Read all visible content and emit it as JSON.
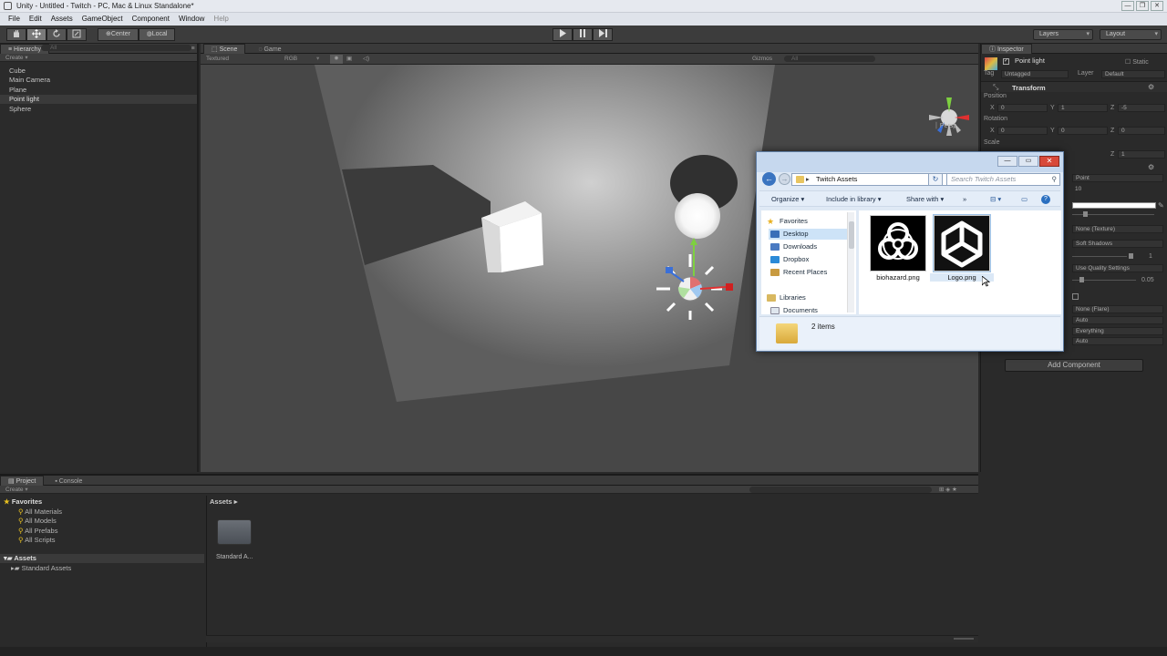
{
  "window": {
    "title": "Unity - Untitled - Twitch - PC, Mac & Linux Standalone*",
    "buttons": [
      "—",
      "❐",
      "✕"
    ]
  },
  "menubar": [
    "File",
    "Edit",
    "Assets",
    "GameObject",
    "Component",
    "Window",
    "Help"
  ],
  "toolbar": {
    "pivot": "Center",
    "space": "Local",
    "layers": "Layers",
    "layout": "Layout"
  },
  "hierarchy": {
    "tab": "Hierarchy",
    "create": "Create",
    "search_placeholder": "All",
    "items": [
      "Cube",
      "Main Camera",
      "Plane",
      "Point light",
      "Sphere"
    ],
    "selected": "Point light"
  },
  "scene": {
    "tab_scene": "Scene",
    "tab_game": "Game",
    "render_mode": "Textured",
    "color_mode": "RGB",
    "gizmos": "Gizmos",
    "gizmo_search": "All",
    "projection": "Persp"
  },
  "inspector": {
    "tab": "Inspector",
    "object_name": "Point light",
    "static": "Static",
    "tag_label": "Tag",
    "tag": "Untagged",
    "layer_label": "Layer",
    "layer": "Default",
    "transform": "Transform",
    "position_label": "Position",
    "position": {
      "x": "0",
      "y": "1",
      "z": "-5"
    },
    "rotation_label": "Rotation",
    "rotation": {
      "x": "0",
      "y": "0",
      "z": "0"
    },
    "scale_label": "Scale",
    "scale_z": "1",
    "light_type": "Point",
    "range": "10",
    "intensity": "1",
    "cookie": "None (Texture)",
    "shadow_type": "Soft Shadows",
    "strength": "1",
    "resolution": "Use Quality Settings",
    "bias": "0.05",
    "flare": "None (Flare)",
    "render_mode": "Auto",
    "culling_mask": "Everything",
    "lightmapping": "Auto",
    "add_component": "Add Component"
  },
  "project": {
    "tab_project": "Project",
    "tab_console": "Console",
    "create": "Create",
    "favorites": "Favorites",
    "favorite_items": [
      "All Materials",
      "All Models",
      "All Prefabs",
      "All Scripts"
    ],
    "assets_root": "Assets",
    "assets_children": [
      "Standard Assets"
    ],
    "breadcrumb": "Assets",
    "asset_items": [
      "Standard A..."
    ]
  },
  "explorer": {
    "address": "Twitch Assets",
    "search_placeholder": "Search Twitch Assets",
    "organize": "Organize",
    "include": "Include in library",
    "share": "Share with",
    "more": "»",
    "favorites": "Favorites",
    "nav_items": [
      "Desktop",
      "Downloads",
      "Dropbox",
      "Recent Places"
    ],
    "libraries": "Libraries",
    "lib_items": [
      "Documents"
    ],
    "files": [
      "biohazard.png",
      "Logo.png"
    ],
    "status": "2 items"
  }
}
